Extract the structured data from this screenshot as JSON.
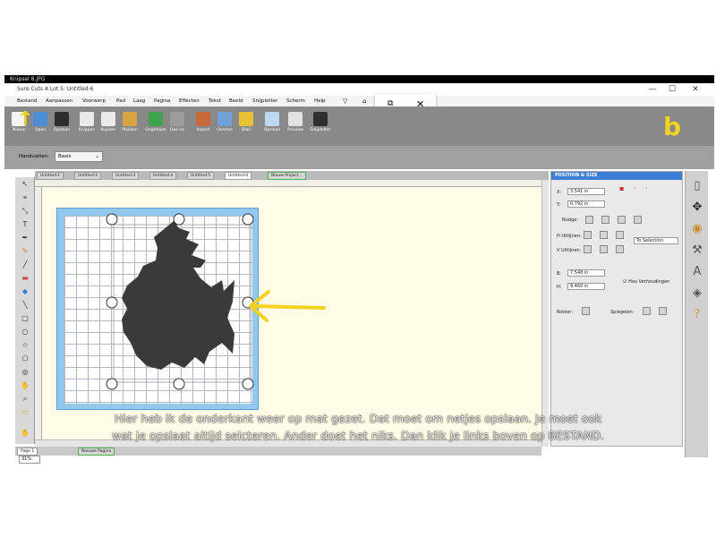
{
  "window": {
    "snip_title": "Knipsel 8.JPG",
    "app_title": "Sure Cuts A Lot 5: Untitled-6",
    "minimize": "—",
    "maximize": "☐",
    "close": "✕"
  },
  "menu": [
    "Bestand",
    "Aanpassen",
    "Voorwerp",
    "Pad",
    "Laag",
    "Pagina",
    "Effecten",
    "Tekst",
    "Beeld",
    "Snijplotter",
    "Scherm",
    "Help"
  ],
  "toolbar": [
    "Nieuw",
    "Open",
    "Opslaan",
    "Knippen",
    "Kopieer",
    "Plakken",
    "Ongedaan",
    "Doe na",
    "Import",
    "Overlee",
    "Bibli",
    "Opslaan",
    "Preview",
    "Snijplotter"
  ],
  "property_bar": {
    "label": "Handvatten:",
    "value": "Basis"
  },
  "doc_tabs": [
    "Untitled-1",
    "Untitled-2",
    "Untitled-3",
    "Untitled-4",
    "Untitled-5",
    "Untitled-6",
    "Nieuw Project..."
  ],
  "page_tabs": {
    "page": "Page 1",
    "new_page": "Nieuwe Pagina"
  },
  "zoom": "31%",
  "panel": {
    "title": "POSITION & SIZE",
    "x_label": "X:",
    "x_value": "3.541 in",
    "y_label": "Y:",
    "y_value": "0.792 in",
    "nudge_label": "Nudge:",
    "h_align_label": "H Uitlijnen:",
    "v_align_label": "V Uitlijnen:",
    "align_to": "To Selection",
    "w_label": "B:",
    "w_value": "7.548 in",
    "h_label": "H:",
    "h_value": "9.460 in",
    "keep_ratio": "Hou Verhoudingen",
    "rotate_label": "Roteer:",
    "mirror_label": "Spiegelen:"
  },
  "annotations": {
    "handwritten_b": "b",
    "arrow_color": "#f3d21f"
  },
  "caption": {
    "line1": "Hier heb ik de onderkant weer op mat gezet. Dat moet om netjes opslaan. Je moet ook",
    "line2": "wat je opslaat altijd selcteren. Ander doet het niks. Dan klik je links boven op BESTAND."
  },
  "colors": {
    "toolbar": "#898989",
    "mat": "#93c8ee",
    "canvas": "#fffbe6",
    "panel_head": "#3d7fd6",
    "shape": "#3a3a3a"
  }
}
